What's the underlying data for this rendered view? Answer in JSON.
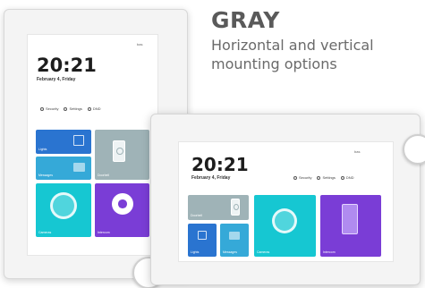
{
  "headline": {
    "title": "GRAY",
    "subtitle_line1": "Horizontal and vertical",
    "subtitle_line2": "mounting options"
  },
  "device_vertical": {
    "time": "20:21",
    "date": "February 4, Friday",
    "brand": "bas",
    "quick_actions": [
      "Security",
      "Settings",
      "DND"
    ],
    "tiles": {
      "lights": "Lights",
      "messages": "Messages",
      "doorbell": "Doorbell",
      "cameras": "Cameras",
      "intercom": "Intercom"
    }
  },
  "device_horizontal": {
    "time": "20:21",
    "date": "February 4, Friday",
    "brand": "bas",
    "quick_actions": [
      "Security",
      "Settings",
      "DND"
    ],
    "tiles": {
      "doorbell": "Doorbell",
      "cameras": "Cameras",
      "intercom": "Intercom",
      "lights": "Lights",
      "messages": "Messages"
    }
  },
  "colors": {
    "lights": "#2a74d0",
    "messages": "#35a9d8",
    "doorbell": "#9fb3b7",
    "cameras": "#16c7d2",
    "intercom": "#7a3dd6",
    "frame": "#f4f4f4"
  }
}
